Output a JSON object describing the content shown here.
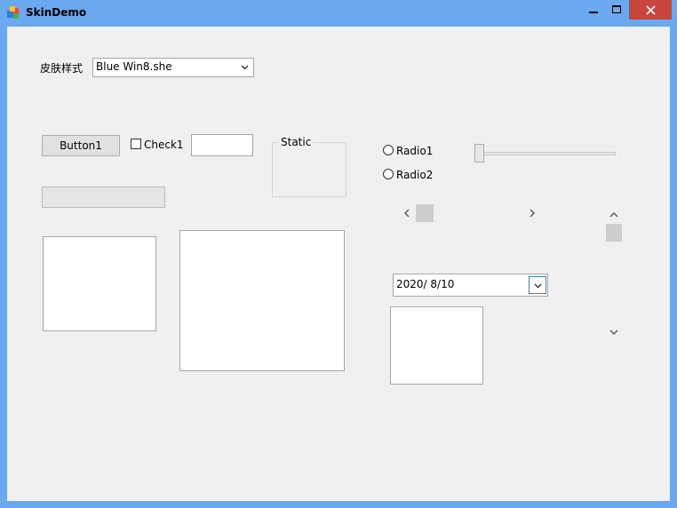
{
  "window": {
    "title": "SkinDemo"
  },
  "skin": {
    "label": "皮肤样式",
    "selected": "Blue Win8.she"
  },
  "controls": {
    "button1": "Button1",
    "check1": "Check1",
    "groupbox": "Static",
    "radio1": "Radio1",
    "radio2": "Radio2",
    "date": "2020/  8/10"
  },
  "colors": {
    "titlebar": "#6aa8f0",
    "close": "#c7453a",
    "client": "#f0f0f0"
  }
}
